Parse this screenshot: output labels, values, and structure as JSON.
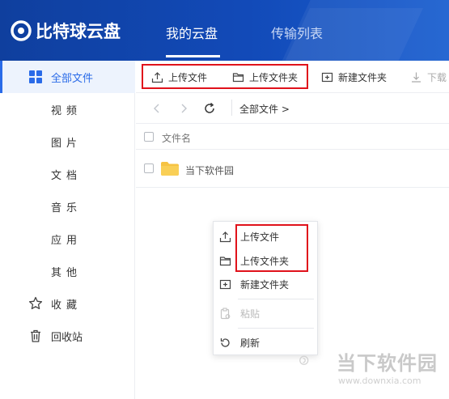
{
  "app": {
    "logo_text": "比特球云盘"
  },
  "nav": {
    "tabs": [
      {
        "label": "我的云盘"
      },
      {
        "label": "传输列表"
      }
    ]
  },
  "sidebar": {
    "items": [
      {
        "label": "全部文件",
        "icon": "grid-icon"
      },
      {
        "label": "视频"
      },
      {
        "label": "图片"
      },
      {
        "label": "文档"
      },
      {
        "label": "音乐"
      },
      {
        "label": "应用"
      },
      {
        "label": "其他"
      },
      {
        "label": "收藏",
        "icon": "star-icon"
      },
      {
        "label": "回收站",
        "icon": "trash-icon"
      }
    ]
  },
  "toolbar": {
    "upload_file": "上传文件",
    "upload_folder": "上传文件夹",
    "new_folder": "新建文件夹",
    "download": "下载"
  },
  "pathbar": {
    "breadcrumb": "全部文件 >"
  },
  "list": {
    "column_name": "文件名",
    "rows": [
      {
        "name": "当下软件园",
        "type": "folder"
      }
    ]
  },
  "context_menu": {
    "items": [
      {
        "label": "上传文件",
        "icon": "upload-icon"
      },
      {
        "label": "上传文件夹",
        "icon": "folder-icon"
      },
      {
        "label": "新建文件夹",
        "icon": "new-folder-icon"
      },
      {
        "label": "粘贴",
        "icon": "paste-icon",
        "disabled": true
      },
      {
        "label": "刷新",
        "icon": "refresh-icon"
      }
    ]
  },
  "watermark": {
    "text": "当下软件园",
    "url": "www.downxia.com"
  },
  "colors": {
    "header": "#124ab8",
    "accent": "#2a6be8",
    "highlight_box": "#e0121b",
    "folder": "#f6c343"
  }
}
